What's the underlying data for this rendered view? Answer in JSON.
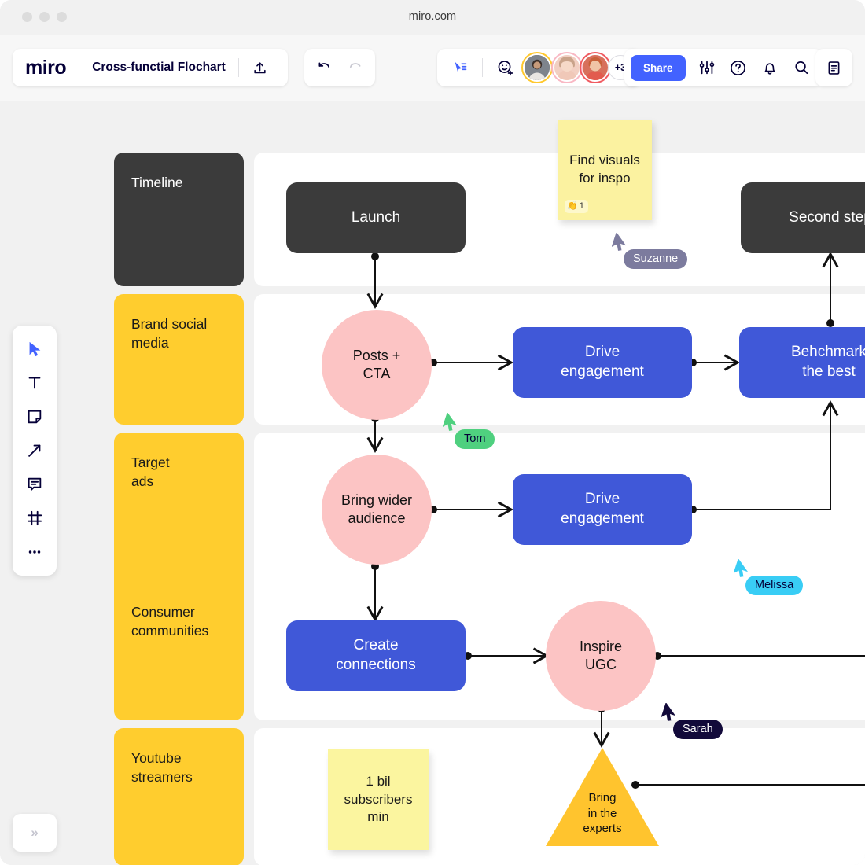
{
  "browser": {
    "url": "miro.com"
  },
  "appbar": {
    "logo": "miro",
    "board_title": "Cross-functial Flochart",
    "upload_icon": "upload-icon",
    "undo_icon": "undo-icon",
    "redo_icon": "redo-icon",
    "cursor_share_icon": "cursor-share-icon",
    "add_reaction_icon": "add-emoji-icon",
    "share_label": "Share",
    "settings_icon": "sliders-icon",
    "help_icon": "question-circle-icon",
    "notifications_icon": "bell-icon",
    "search_icon": "search-icon",
    "notes_icon": "notes-panel-icon",
    "collaborators": [
      {
        "name": "collaborator-1",
        "ring": "#ffc82e"
      },
      {
        "name": "collaborator-2",
        "ring": "#f9b8c4"
      },
      {
        "name": "collaborator-3",
        "ring": "#f05a60"
      }
    ],
    "collaborators_overflow": "+3"
  },
  "tools": [
    {
      "name": "select-tool",
      "icon": "cursor-icon",
      "active": true
    },
    {
      "name": "text-tool",
      "icon": "text-icon",
      "active": false
    },
    {
      "name": "sticky-note-tool",
      "icon": "sticky-note-icon",
      "active": false
    },
    {
      "name": "arrow-tool",
      "icon": "arrow-icon",
      "active": false
    },
    {
      "name": "comment-tool",
      "icon": "comment-icon",
      "active": false
    },
    {
      "name": "frame-tool",
      "icon": "frame-icon",
      "active": false
    },
    {
      "name": "more-tools",
      "icon": "ellipsis-icon",
      "active": false
    }
  ],
  "bottom_panel": {
    "expand_label": "»"
  },
  "chart_data": {
    "type": "diagram",
    "title": "Cross-functial Flochart",
    "lanes": [
      {
        "label": "Timeline",
        "style": "dark"
      },
      {
        "label": "Brand social\nmedia",
        "style": "yellow"
      },
      {
        "label": "Target\nads",
        "style": "yellow"
      },
      {
        "label": "Consumer\ncommunities",
        "style": "yellow"
      },
      {
        "label": "Youtube\nstreamers",
        "style": "yellow"
      }
    ],
    "nodes": [
      {
        "id": "launch",
        "label": "Launch",
        "shape": "rect",
        "color": "#3b3b3b",
        "lane": "Timeline"
      },
      {
        "id": "second-step",
        "label": "Second step",
        "shape": "rect",
        "color": "#3b3b3b",
        "lane": "Timeline"
      },
      {
        "id": "posts-cta",
        "label": "Posts +\nCTA",
        "shape": "circle",
        "color": "#fcc4c4",
        "lane": "Brand social media"
      },
      {
        "id": "drive-engagement-1",
        "label": "Drive\nengagement",
        "shape": "rect",
        "color": "#4058d8",
        "lane": "Brand social media"
      },
      {
        "id": "benchmark-the-best",
        "label": "Behchmark\nthe best",
        "shape": "rect",
        "color": "#4058d8",
        "lane": "Brand social media"
      },
      {
        "id": "bring-wider-audience",
        "label": "Bring wider\naudience",
        "shape": "circle",
        "color": "#fcc4c4",
        "lane": "Target ads"
      },
      {
        "id": "drive-engagement-2",
        "label": "Drive\nengagement",
        "shape": "rect",
        "color": "#4058d8",
        "lane": "Target ads"
      },
      {
        "id": "create-connections",
        "label": "Create\nconnections",
        "shape": "rect",
        "color": "#4058d8",
        "lane": "Consumer communities"
      },
      {
        "id": "inspire-ugc",
        "label": "Inspire\nUGC",
        "shape": "circle",
        "color": "#fcc4c4",
        "lane": "Consumer communities"
      },
      {
        "id": "bring-in-the-experts",
        "label": "Bring\nin the\nexperts",
        "shape": "triangle",
        "color": "#ffc42e",
        "lane": "Youtube streamers"
      }
    ],
    "edges": [
      {
        "from": "launch",
        "to": "posts-cta"
      },
      {
        "from": "posts-cta",
        "to": "drive-engagement-1"
      },
      {
        "from": "drive-engagement-1",
        "to": "benchmark-the-best"
      },
      {
        "from": "benchmark-the-best",
        "to": "second-step"
      },
      {
        "from": "posts-cta",
        "to": "bring-wider-audience"
      },
      {
        "from": "bring-wider-audience",
        "to": "drive-engagement-2"
      },
      {
        "from": "drive-engagement-2",
        "to": "benchmark-the-best"
      },
      {
        "from": "bring-wider-audience",
        "to": "create-connections"
      },
      {
        "from": "create-connections",
        "to": "inspire-ugc"
      },
      {
        "from": "inspire-ugc",
        "to": "bring-in-the-experts"
      }
    ],
    "sticky_notes": [
      {
        "id": "note-inspo",
        "text": "Find visuals\nfor inspo",
        "color": "#fbf2a0",
        "reaction_emoji": "👏",
        "reaction_count": "1"
      },
      {
        "id": "note-subscribers",
        "text": "1 bil\nsubscribers\nmin",
        "color": "#fbf59f",
        "reaction_count": ""
      }
    ],
    "cursors": [
      {
        "name": "Suzanne",
        "color": "#7c7b9e",
        "text_color": "#ffffff"
      },
      {
        "name": "Tom",
        "color": "#4fd07f",
        "text_color": "#050038"
      },
      {
        "name": "Melissa",
        "color": "#39cdf5",
        "text_color": "#050038"
      },
      {
        "name": "Sarah",
        "color": "#120a3a",
        "text_color": "#ffffff"
      }
    ]
  },
  "nodes_text": {
    "launch": "Launch",
    "second_step": "Second step",
    "posts_cta_l1": "Posts +",
    "posts_cta_l2": "CTA",
    "drive_engagement_1_l1": "Drive",
    "drive_engagement_1_l2": "engagement",
    "benchmark_l1": "Behchmark",
    "benchmark_l2": "the best",
    "bring_wider_l1": "Bring wider",
    "bring_wider_l2": "audience",
    "drive_engagement_2_l1": "Drive",
    "drive_engagement_2_l2": "engagement",
    "create_connections_l1": "Create",
    "create_connections_l2": "connections",
    "inspire_ugc_l1": "Inspire",
    "inspire_ugc_l2": "UGC",
    "experts_l1": "Bring",
    "experts_l2": "in the",
    "experts_l3": "experts"
  },
  "lanes_text": {
    "timeline": "Timeline",
    "brand_l1": "Brand social",
    "brand_l2": "media",
    "target_l1": "Target",
    "target_l2": "ads",
    "consumer_l1": "Consumer",
    "consumer_l2": "communities",
    "youtube_l1": "Youtube",
    "youtube_l2": "streamers"
  },
  "notes_text": {
    "inspo_l1": "Find visuals",
    "inspo_l2": "for inspo",
    "inspo_reaction_emoji": "👏",
    "inspo_reaction_count": "1",
    "subs_l1": "1 bil",
    "subs_l2": "subscribers",
    "subs_l3": "min"
  },
  "cursor_text": {
    "suzanne": "Suzanne",
    "tom": "Tom",
    "melissa": "Melissa",
    "sarah": "Sarah"
  }
}
